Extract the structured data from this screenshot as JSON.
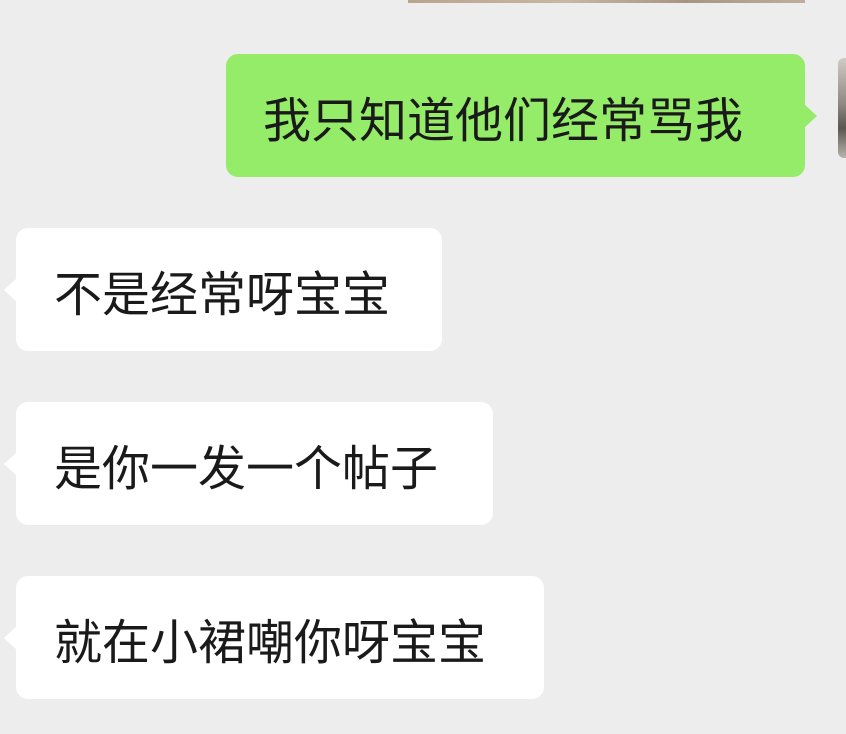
{
  "messages": [
    {
      "direction": "sent",
      "text": "我只知道他们经常骂我"
    },
    {
      "direction": "received",
      "text": "不是经常呀宝宝"
    },
    {
      "direction": "received",
      "text": "是你一发一个帖子"
    },
    {
      "direction": "received",
      "text": "就在小裙嘲你呀宝宝"
    }
  ]
}
